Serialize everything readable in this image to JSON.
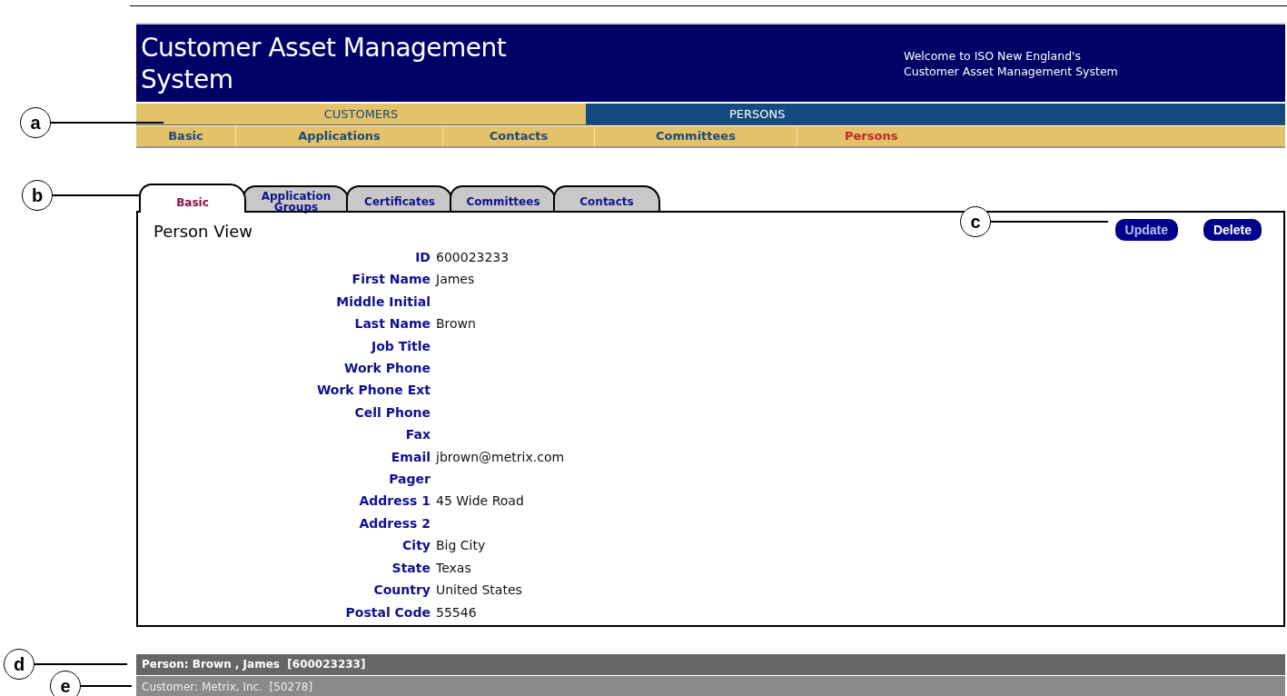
{
  "header": {
    "title": "Customer Asset Management System",
    "welcome": [
      "Welcome to ISO New England's",
      "Customer Asset Management System"
    ]
  },
  "sections": [
    {
      "label": "CUSTOMERS",
      "selected": false
    },
    {
      "label": "PERSONS",
      "selected": true
    }
  ],
  "subnav": [
    {
      "label": "Basic",
      "selected": false
    },
    {
      "label": "Applications",
      "selected": false
    },
    {
      "label": "Contacts",
      "selected": false
    },
    {
      "label": "Committees",
      "selected": false
    },
    {
      "label": "Persons",
      "selected": true
    }
  ],
  "tabs": [
    {
      "label": "Basic",
      "selected": true
    },
    {
      "label": "Application Groups",
      "selected": false
    },
    {
      "label": "Certificates",
      "selected": false
    },
    {
      "label": "Committees",
      "selected": false
    },
    {
      "label": "Contacts",
      "selected": false
    }
  ],
  "panel": {
    "title": "Person View",
    "buttons": [
      "Update",
      "Delete"
    ]
  },
  "fields": [
    {
      "label": "ID",
      "value": "600023233"
    },
    {
      "label": "First Name",
      "value": "James"
    },
    {
      "label": "Middle Initial"
    },
    {
      "label": "Last Name",
      "value": "Brown"
    },
    {
      "label": "Job Title"
    },
    {
      "label": "Work Phone"
    },
    {
      "label": "Work Phone Ext"
    },
    {
      "label": "Cell Phone"
    },
    {
      "label": "Fax"
    },
    {
      "label": "Email",
      "value": "jbrown@metrix.com"
    },
    {
      "label": "Pager"
    },
    {
      "label": "Address 1",
      "value": "45 Wide Road"
    },
    {
      "label": "Address 2"
    },
    {
      "label": "City",
      "value": "Big City"
    },
    {
      "label": "State",
      "value": "Texas"
    },
    {
      "label": "Country",
      "value": "United States"
    },
    {
      "label": "Postal Code",
      "value": "55546"
    }
  ],
  "status_bar": {
    "person": "Person: Brown , James  [600023233]",
    "customer": "Customer: Metrix, Inc.  [50278]"
  },
  "callouts": [
    "a",
    "b",
    "c",
    "d",
    "e"
  ]
}
